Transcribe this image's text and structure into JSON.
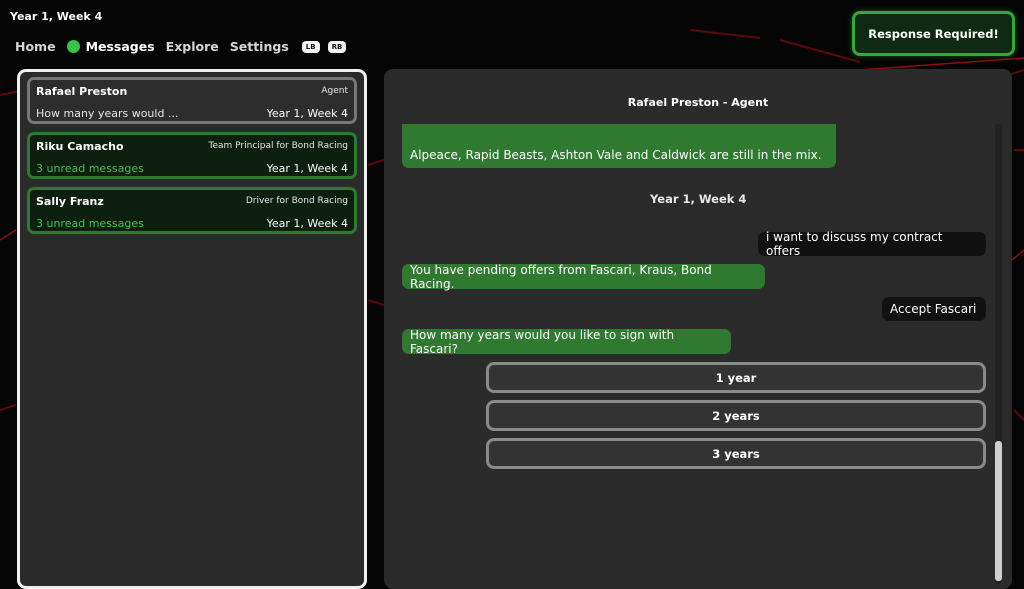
{
  "header": {
    "date": "Year 1, Week 4"
  },
  "nav": {
    "items": [
      {
        "label": "Home"
      },
      {
        "label": "Messages"
      },
      {
        "label": "Explore"
      },
      {
        "label": "Settings"
      }
    ],
    "lb": "LB",
    "rb": "RB",
    "active_color": "#39c24a"
  },
  "response_button": {
    "label": "Response Required!"
  },
  "conversations": [
    {
      "name": "Rafael Preston",
      "role": "Agent",
      "preview": "How many years would ...",
      "date": "Year 1, Week 4",
      "unread": false
    },
    {
      "name": "Riku Camacho",
      "role": "Team Principal for Bond Racing",
      "preview": "3 unread messages",
      "date": "Year 1, Week 4",
      "unread": true
    },
    {
      "name": "Sally Franz",
      "role": "Driver for Bond Racing",
      "preview": "3 unread messages",
      "date": "Year 1, Week 4",
      "unread": true
    }
  ],
  "chat": {
    "title": "Rafael Preston - Agent",
    "messages": [
      {
        "text": "Alpeace, Rapid Beasts, Ashton Vale and Caldwick are still in the mix.",
        "from": "agent"
      },
      {
        "text": "i want to discuss my contract offers",
        "from": "player"
      },
      {
        "text": "You have pending offers from Fascari, Kraus, Bond Racing.",
        "from": "agent"
      },
      {
        "text": "Accept Fascari",
        "from": "player"
      },
      {
        "text": "How many years would you like to sign with Fascari?",
        "from": "agent"
      }
    ],
    "date_separator": "Year 1, Week 4",
    "choices": [
      "1 year",
      "2 years",
      "3 years"
    ]
  },
  "colors": {
    "accent_green": "#2f7a30",
    "unread_text": "#46c24f"
  }
}
